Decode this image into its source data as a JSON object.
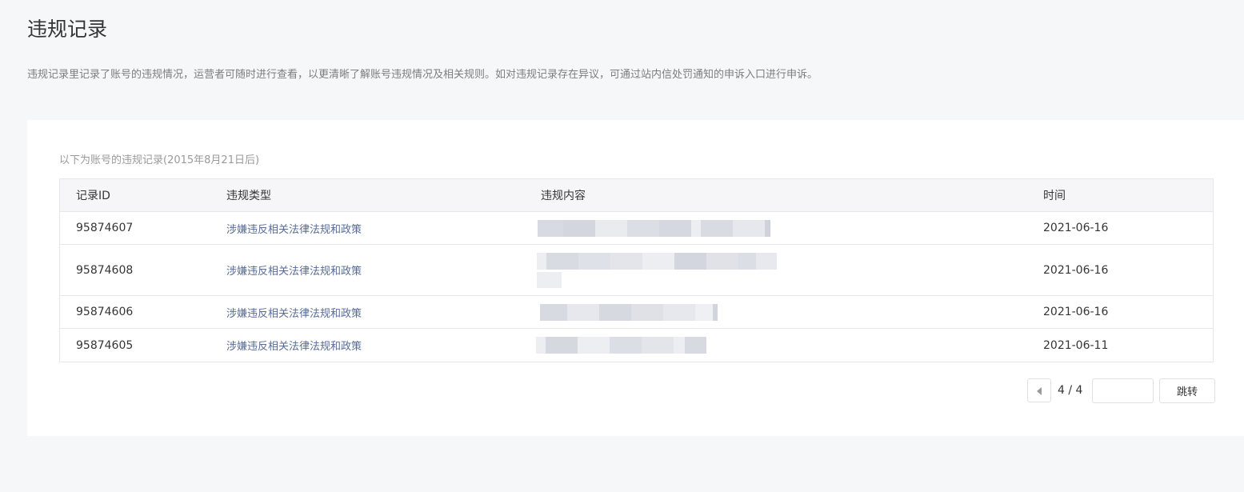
{
  "page": {
    "title": "违规记录",
    "description": "违规记录里记录了账号的违规情况，运营者可随时进行查看，以更清晰了解账号违规情况及相关规则。如对违规记录存在异议，可通过站内信处罚通知的申诉入口进行申诉。"
  },
  "table": {
    "caption": "以下为账号的违规记录(2015年8月21日后)",
    "headers": {
      "id": "记录ID",
      "type": "违规类型",
      "content": "违规内容",
      "time": "时间"
    },
    "rows": [
      {
        "id": "95874607",
        "type": "涉嫌违反相关法律法规和政策",
        "time": "2021-06-16"
      },
      {
        "id": "95874608",
        "type": "涉嫌违反相关法律法规和政策",
        "time": "2021-06-16"
      },
      {
        "id": "95874606",
        "type": "涉嫌违反相关法律法规和政策",
        "time": "2021-06-16"
      },
      {
        "id": "95874605",
        "type": "涉嫌违反相关法律法规和政策",
        "time": "2021-06-11"
      }
    ]
  },
  "pagination": {
    "page_indicator": "4 / 4",
    "jump_input_value": "",
    "jump_label": "跳转",
    "prev_icon": "triangle-left-icon"
  },
  "colors": {
    "page_background": "#f6f7f9",
    "card_background": "#ffffff",
    "type_link": "#576b95",
    "header_background": "#f6f6f9",
    "border": "#e7e7eb"
  }
}
